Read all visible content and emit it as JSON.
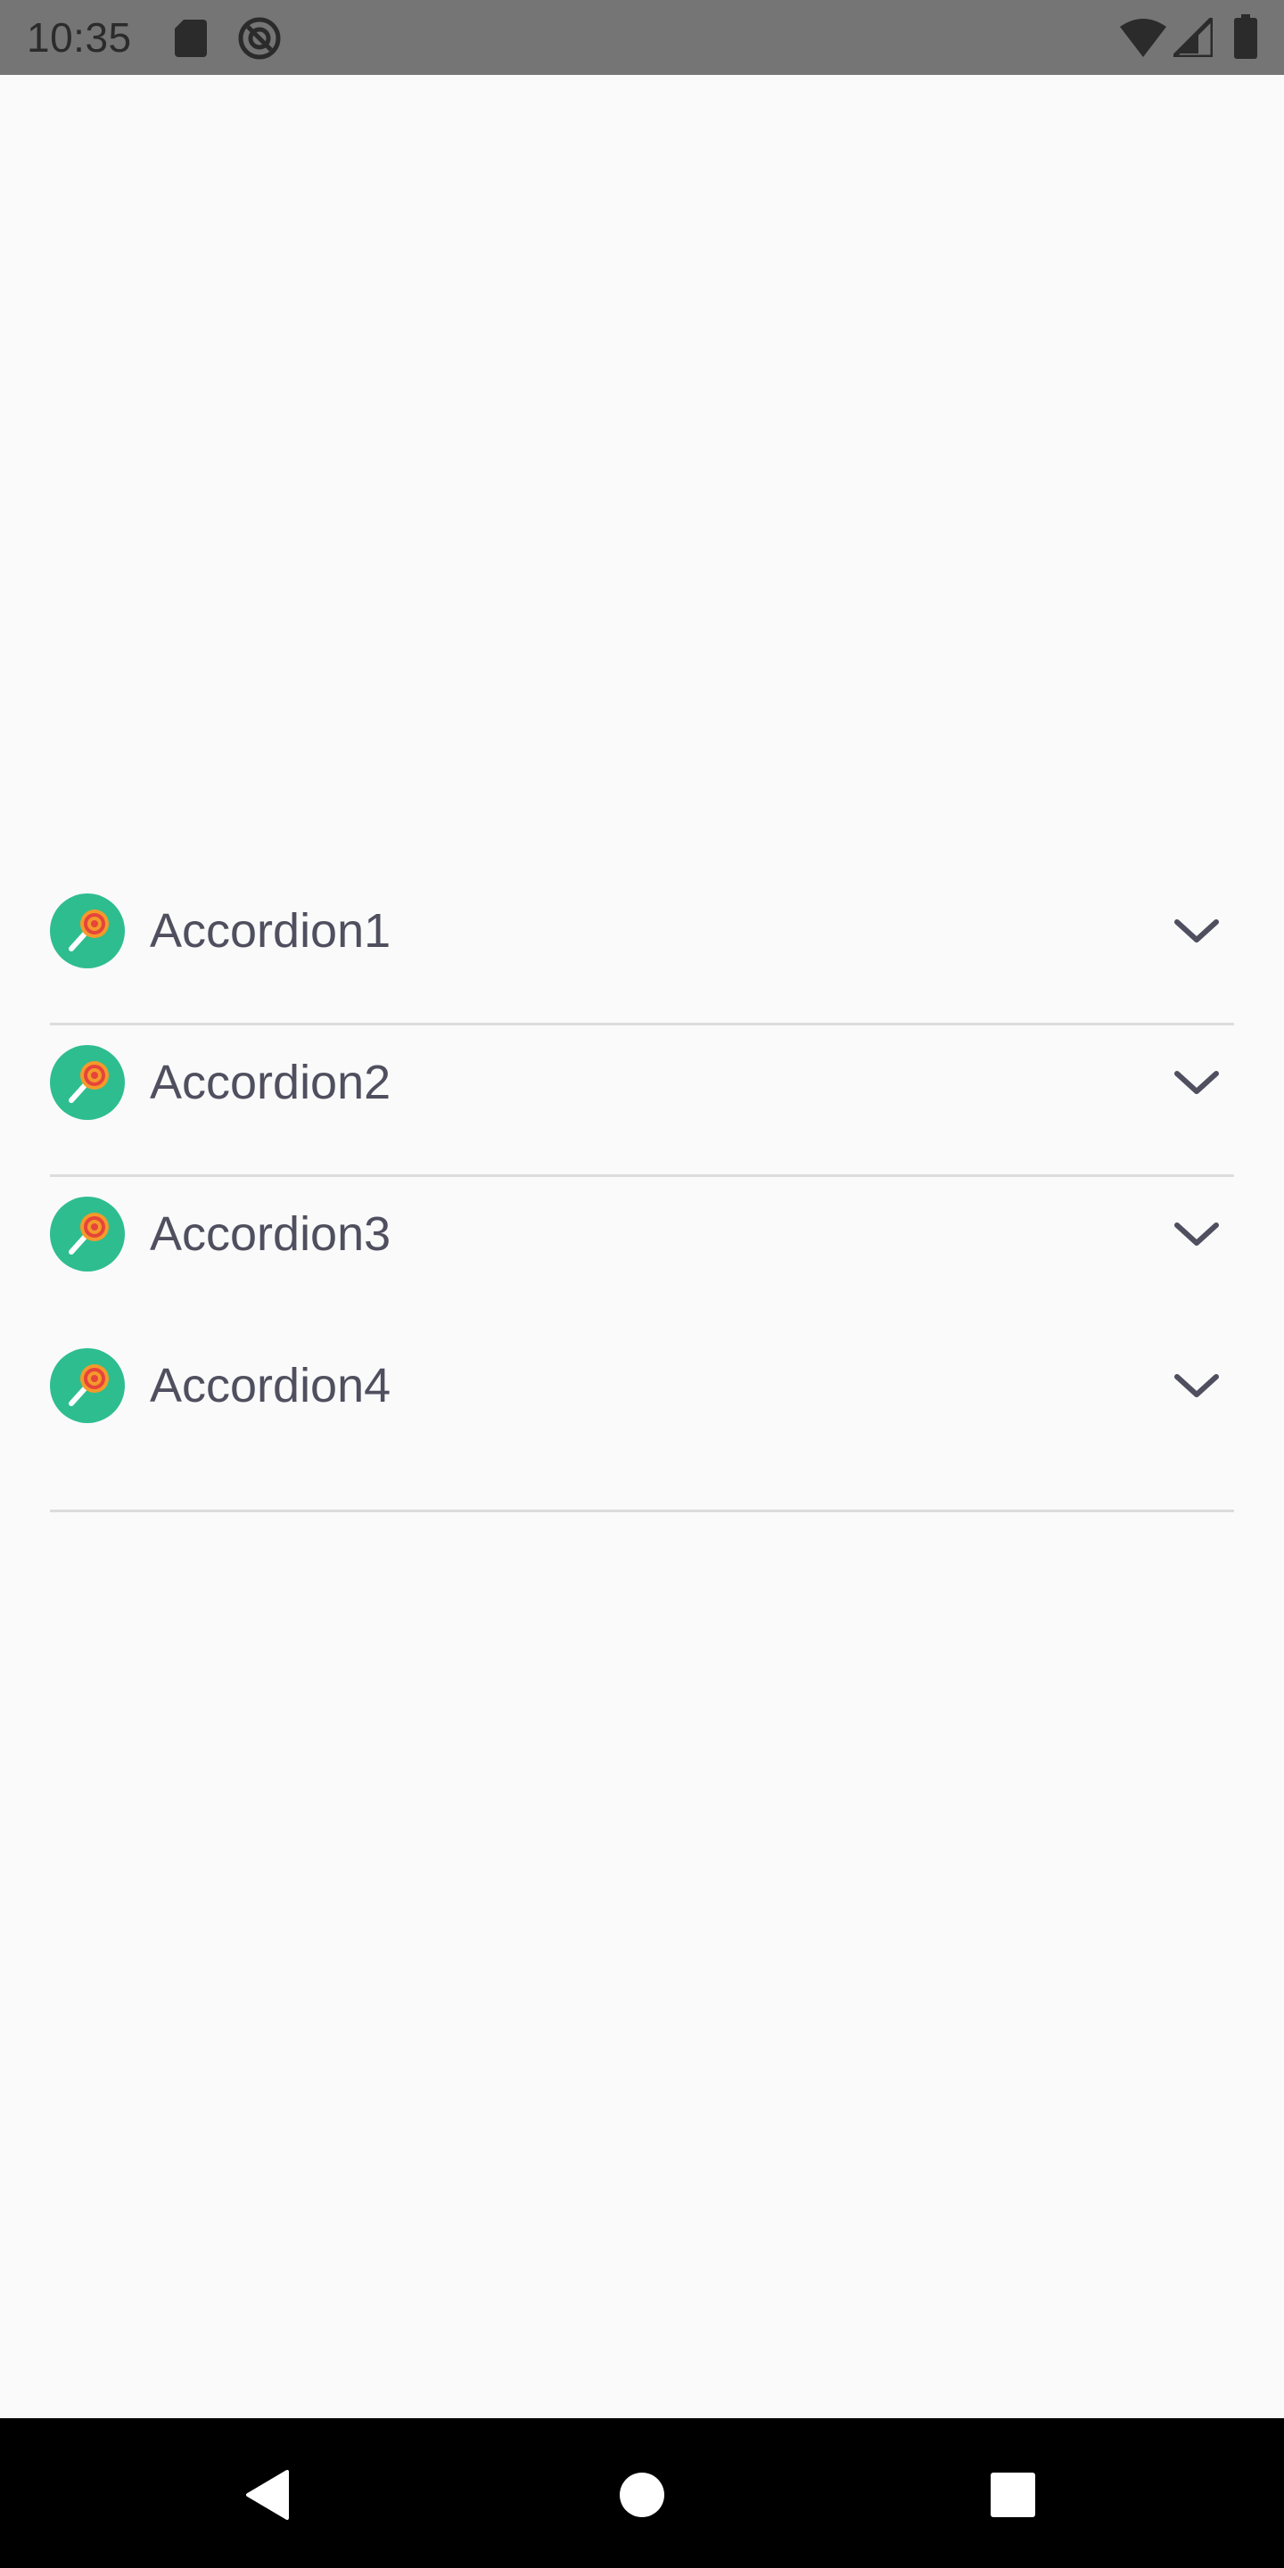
{
  "status_bar": {
    "time": "10:35",
    "icons": [
      "sd-card-icon",
      "sync-icon",
      "wifi-icon",
      "signal-icon",
      "battery-icon"
    ]
  },
  "accordion": {
    "icon": "lollipop-icon",
    "chevron_icon": "chevron-down-icon",
    "colors": {
      "icon_background": "#2ebd8f",
      "label_text": "#4f4f5f",
      "divider": "#dcdcdc"
    },
    "items": [
      {
        "label": "Accordion1"
      },
      {
        "label": "Accordion2"
      },
      {
        "label": "Accordion3"
      },
      {
        "label": "Accordion4"
      }
    ]
  },
  "nav_bar": {
    "icons": [
      "back-icon",
      "home-icon",
      "recents-icon"
    ]
  }
}
